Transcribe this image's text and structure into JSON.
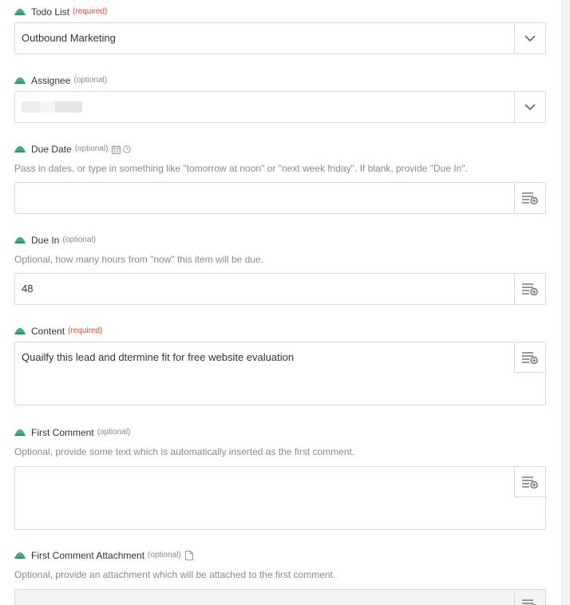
{
  "fields": {
    "todo_list": {
      "label": "Todo List",
      "tag": "(required)",
      "value": "Outbound Marketing"
    },
    "assignee": {
      "label": "Assignee",
      "tag": "(optional)",
      "value": ""
    },
    "due_date": {
      "label": "Due Date",
      "tag": "(optional)",
      "help": "Pass in dates, or type in something like \"tomorrow at noon\" or \"next week friday\". If blank, provide \"Due In\".",
      "value": ""
    },
    "due_in": {
      "label": "Due In",
      "tag": "(optional)",
      "help": "Optional, how many hours from \"now\" this item will be due.",
      "value": "48"
    },
    "content": {
      "label": "Content",
      "tag": "(required)",
      "value": "Quailfy this lead and dtermine fit for free website evaluation"
    },
    "first_comment": {
      "label": "First Comment",
      "tag": "(optional)",
      "help": "Optional, provide some text which is automatically inserted as the first comment.",
      "value": ""
    },
    "first_comment_attachment": {
      "label": "First Comment Attachment",
      "tag": "(optional)",
      "help": "Optional, provide an attachment which will be attached to the first comment.",
      "value": ""
    }
  },
  "icons": {
    "app": "basecamp-icon",
    "dropdown": "chevron-down-icon",
    "insert_data": "insert-data-icon",
    "calendar": "calendar-icon",
    "clock": "clock-icon",
    "file": "file-icon"
  },
  "colors": {
    "required": "#e8452c",
    "optional": "#888888",
    "app_icon": "#3fb07a",
    "border": "#d9d9d9"
  }
}
